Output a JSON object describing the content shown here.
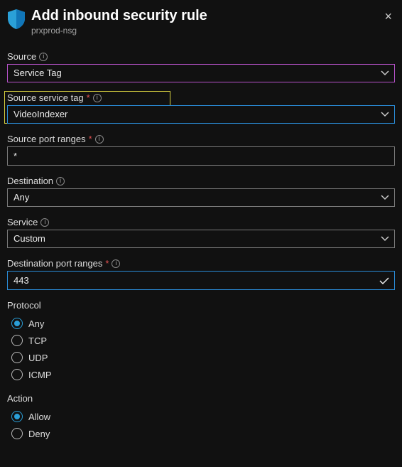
{
  "header": {
    "title": "Add inbound security rule",
    "subtitle": "prxprod-nsg",
    "close_glyph": "×"
  },
  "fields": {
    "source": {
      "label": "Source",
      "value": "Service Tag"
    },
    "source_service_tag": {
      "label": "Source service tag",
      "value": "VideoIndexer"
    },
    "source_port_ranges": {
      "label": "Source port ranges",
      "value": "*"
    },
    "destination": {
      "label": "Destination",
      "value": "Any"
    },
    "service": {
      "label": "Service",
      "value": "Custom"
    },
    "destination_port_ranges": {
      "label": "Destination port ranges",
      "value": "443"
    }
  },
  "protocol": {
    "label": "Protocol",
    "options": [
      "Any",
      "TCP",
      "UDP",
      "ICMP"
    ],
    "selected": "Any"
  },
  "action": {
    "label": "Action",
    "options": [
      "Allow",
      "Deny"
    ],
    "selected": "Allow"
  }
}
